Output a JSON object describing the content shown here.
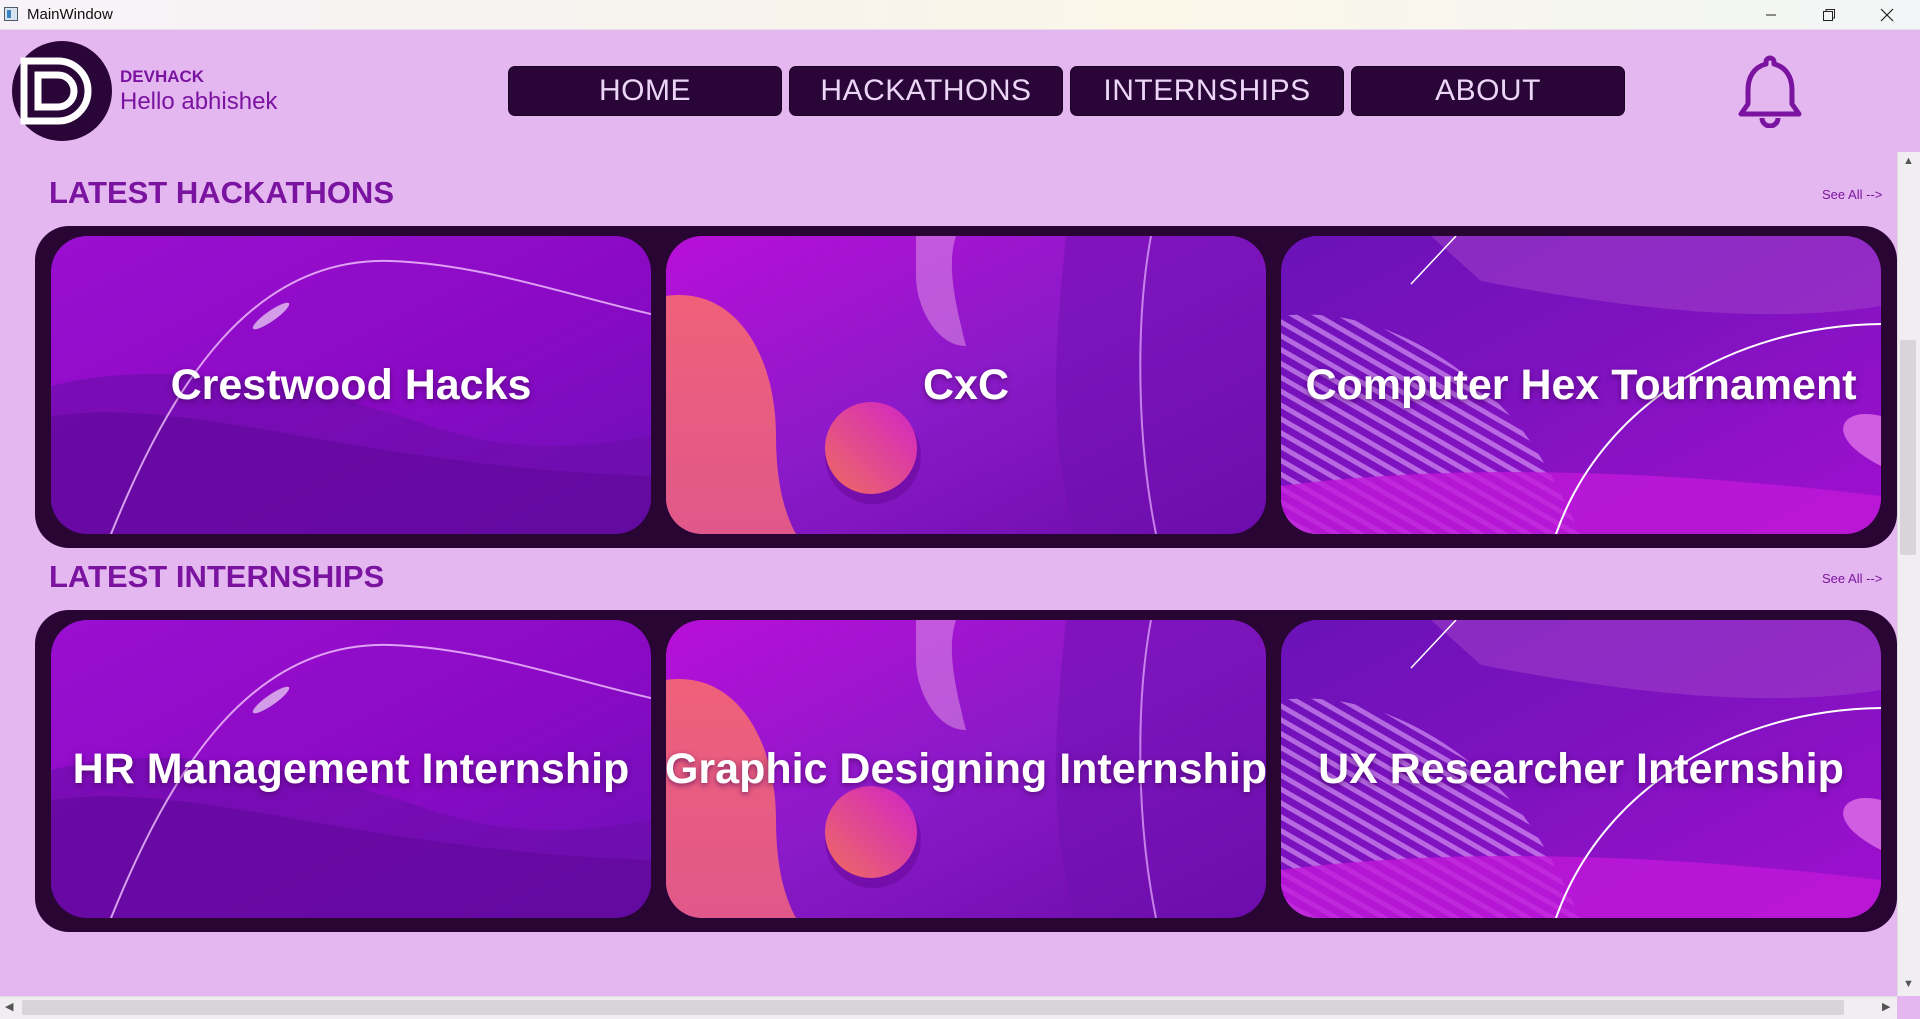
{
  "window": {
    "title": "MainWindow",
    "controls": [
      "minimize-icon",
      "restore-icon",
      "close-icon"
    ]
  },
  "header": {
    "brand": "DEVHACK",
    "greeting": "Hello abhishek",
    "logo_icon": "devhack-logo",
    "bell_icon": "bell-icon",
    "nav": [
      {
        "label": "HOME"
      },
      {
        "label": "HACKATHONS"
      },
      {
        "label": "INTERNSHIPS"
      },
      {
        "label": "ABOUT"
      }
    ]
  },
  "hackathons": {
    "title": "LATEST HACKATHONS",
    "see_all": "See All -->",
    "cards": [
      {
        "title": "Crestwood Hacks"
      },
      {
        "title": "CxC"
      },
      {
        "title": "Computer Hex Tournament"
      }
    ]
  },
  "internships": {
    "title": "LATEST INTERNSHIPS",
    "see_all": "See All -->",
    "cards": [
      {
        "title": "HR Management Internship"
      },
      {
        "title": "Graphic Designing Internship"
      },
      {
        "title": "UX Researcher Internship"
      }
    ]
  },
  "colors": {
    "background": "#e5b7f1",
    "accent": "#7a14a0",
    "nav_bg": "#2a0537",
    "panel_bg": "#280533"
  }
}
